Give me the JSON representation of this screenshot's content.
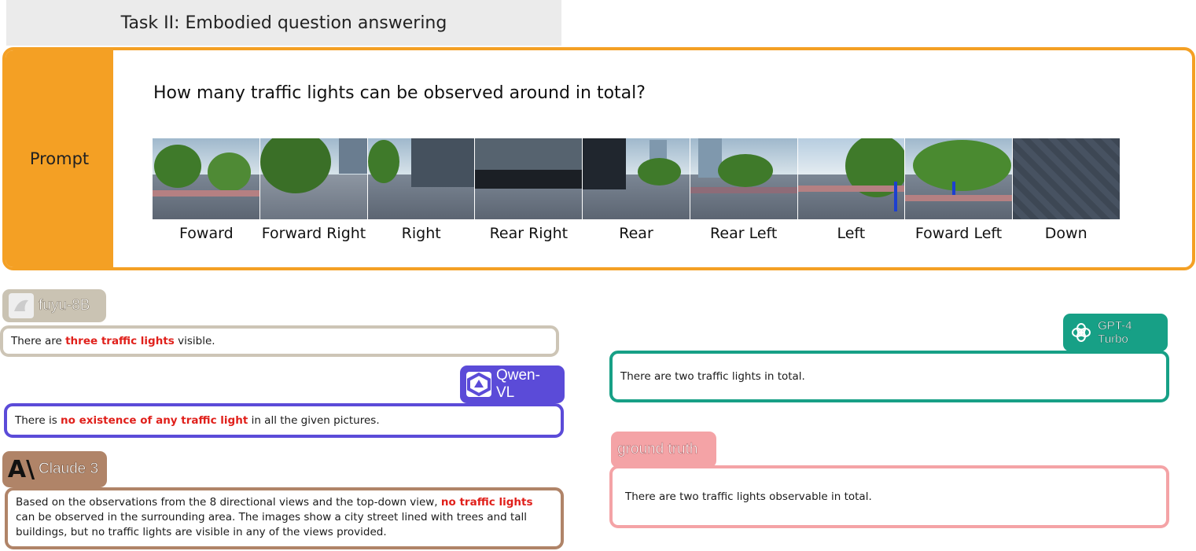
{
  "header": {
    "title": "Task II: Embodied question answering"
  },
  "prompt": {
    "label": "Prompt",
    "question": "How many traffic lights can be observed around in total?",
    "views": [
      {
        "label": "Foward",
        "icon": "street-view-image"
      },
      {
        "label": "Forward Right",
        "icon": "street-view-image"
      },
      {
        "label": "Right",
        "icon": "street-view-image"
      },
      {
        "label": "Rear Right",
        "icon": "street-view-image"
      },
      {
        "label": "Rear",
        "icon": "street-view-image"
      },
      {
        "label": "Rear Left",
        "icon": "street-view-image"
      },
      {
        "label": "Left",
        "icon": "street-view-image"
      },
      {
        "label": "Foward Left",
        "icon": "street-view-image"
      },
      {
        "label": "Down",
        "icon": "street-view-image"
      }
    ]
  },
  "models": {
    "fuyu": {
      "name": "fuyu-8B",
      "color": "#cac3b3",
      "pre": "There are ",
      "highlight": "three traffic lights",
      "post": " visible."
    },
    "qwen": {
      "name": "Qwen-VL",
      "color": "#5b4bd8",
      "pre": "There is ",
      "highlight": "no existence of any traffic light",
      "post": " in all the given pictures."
    },
    "claude": {
      "name": "Claude 3",
      "color": "#b08468",
      "pre": "Based on the observations from the 8 directional views and the top-down view, ",
      "highlight": "no traffic lights",
      "post": " can be observed in the surrounding area. The images show a city street lined with trees and tall buildings, but no traffic lights are visible in any of the views provided."
    },
    "gpt": {
      "name": "GPT-4 Turbo",
      "color": "#17a086",
      "answer": "There are two traffic lights in total."
    },
    "ground_truth": {
      "name": "ground truth",
      "color": "#f4a3a6",
      "answer": "There are two traffic lights observable in total."
    }
  },
  "colors": {
    "prompt_accent": "#f4a024",
    "highlight": "#e0201b"
  }
}
